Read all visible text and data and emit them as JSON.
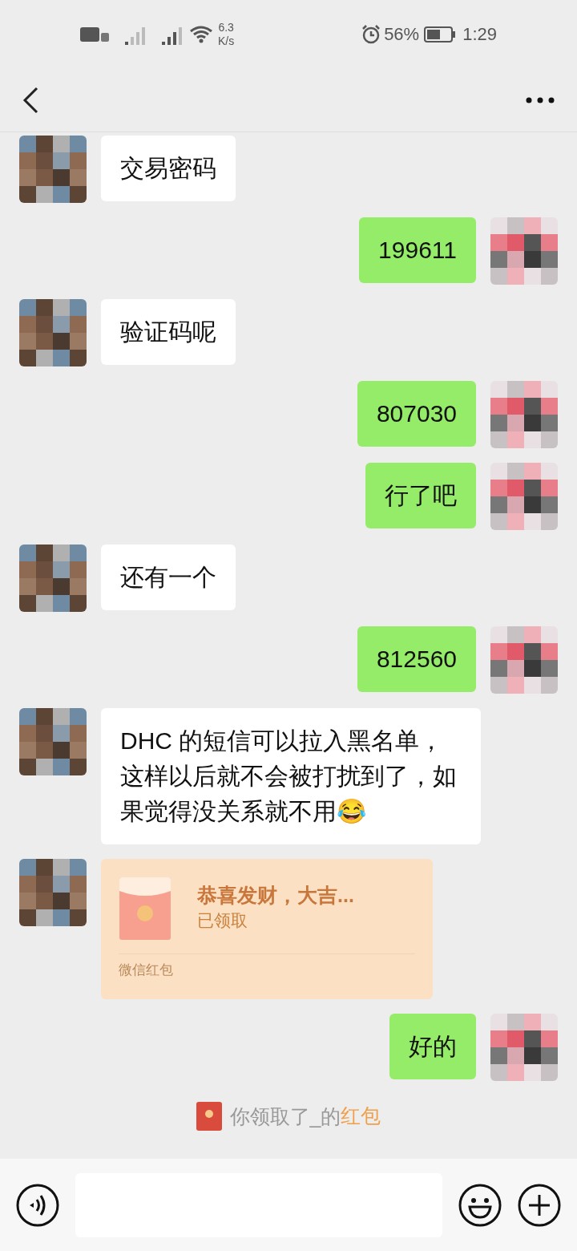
{
  "status_bar": {
    "network_speed": "6.3",
    "speed_unit": "K/s",
    "battery_text": "56%",
    "time": "1:29"
  },
  "messages": [
    {
      "kind": "text",
      "outgoing": false,
      "text": "交易密码"
    },
    {
      "kind": "text",
      "outgoing": true,
      "text": "199611"
    },
    {
      "kind": "text",
      "outgoing": false,
      "text": "验证码呢"
    },
    {
      "kind": "text",
      "outgoing": true,
      "text": "807030"
    },
    {
      "kind": "text",
      "outgoing": true,
      "text": "行了吧"
    },
    {
      "kind": "text",
      "outgoing": false,
      "text": "还有一个"
    },
    {
      "kind": "text",
      "outgoing": true,
      "text": "812560"
    },
    {
      "kind": "text",
      "outgoing": false,
      "text": "DHC 的短信可以拉入黑名单，这样以后就不会被打扰到了，如果觉得没关系就不用😂"
    },
    {
      "kind": "red_packet",
      "outgoing": false,
      "title": "恭喜发财，大吉...",
      "status": "已领取",
      "footer": "微信红包"
    },
    {
      "kind": "text",
      "outgoing": true,
      "text": "好的"
    }
  ],
  "notice": {
    "text": "你领取了_的",
    "link": "红包"
  }
}
